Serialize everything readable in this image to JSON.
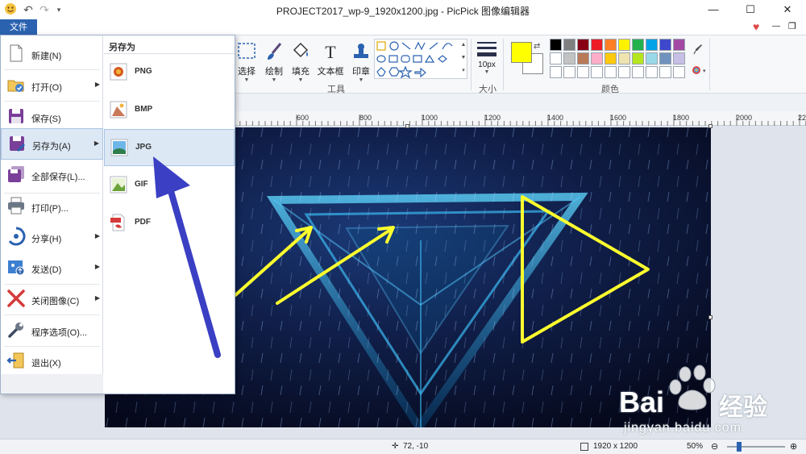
{
  "window": {
    "title": "PROJECT2017_wp-9_1920x1200.jpg - PicPick 图像编辑器",
    "minimize": "—",
    "maximize": "☐",
    "close": "✕"
  },
  "quick_access": {
    "undo": "↶",
    "redo": "↷",
    "more": "▾"
  },
  "ribbon_tab": {
    "file": "文件"
  },
  "ribbon_right": {
    "heart": "♥",
    "min": "—",
    "restore": "❐"
  },
  "ribbon": {
    "tools": [
      {
        "label": "选择",
        "icon": "select-icon"
      },
      {
        "label": "绘制",
        "icon": "brush-icon"
      },
      {
        "label": "填充",
        "icon": "bucket-icon"
      },
      {
        "label": "文本框",
        "icon": "text-icon"
      },
      {
        "label": "印章",
        "icon": "stamp-icon"
      }
    ],
    "tools_group_label": "工具",
    "size_label": "10px",
    "size_group_label": "大小",
    "colors_group_label": "颜色",
    "primary_color": "#ffff00",
    "secondary_color": "#ffffff",
    "palette": [
      "#000000",
      "#7f7f7f",
      "#880015",
      "#ed1c24",
      "#ff7f27",
      "#fff200",
      "#22b14c",
      "#00a2e8",
      "#3f48cc",
      "#a349a4",
      "#ffffff",
      "#c3c3c3",
      "#b97a57",
      "#ffaec9",
      "#ffc90e",
      "#efe4b0",
      "#b5e61d",
      "#99d9ea",
      "#7092be",
      "#c8bfe7",
      "#ffffff",
      "#ffffff",
      "#ffffff",
      "#ffffff",
      "#ffffff",
      "#ffffff",
      "#ffffff",
      "#ffffff",
      "#ffffff",
      "#ffffff"
    ]
  },
  "ruler": {
    "ticks": [
      "600",
      "800",
      "1000",
      "1200",
      "1400",
      "1600",
      "1800",
      "2000",
      "22"
    ]
  },
  "file_menu": {
    "items": [
      {
        "label": "新建(N)",
        "icon": "new-file-icon",
        "submenu": false
      },
      {
        "label": "打开(O)",
        "icon": "open-folder-icon",
        "submenu": true
      },
      {
        "label": "保存(S)",
        "icon": "save-icon",
        "submenu": false
      },
      {
        "label": "另存为(A)",
        "icon": "save-as-icon",
        "submenu": true
      },
      {
        "label": "全部保存(L)...",
        "icon": "save-all-icon",
        "submenu": false
      },
      {
        "label": "打印(P)...",
        "icon": "printer-icon",
        "submenu": false
      },
      {
        "label": "分享(H)",
        "icon": "share-icon",
        "submenu": true
      },
      {
        "label": "发送(D)",
        "icon": "send-icon",
        "submenu": true
      },
      {
        "label": "关闭图像(C)",
        "icon": "close-image-icon",
        "submenu": true
      },
      {
        "label": "程序选项(O)...",
        "icon": "wrench-icon",
        "submenu": false
      },
      {
        "label": "退出(X)",
        "icon": "exit-icon",
        "submenu": false
      }
    ],
    "submenu_arrow": "▶",
    "save_as_title": "另存为",
    "formats": [
      {
        "label": "PNG",
        "icon": "png-file-icon"
      },
      {
        "label": "BMP",
        "icon": "bmp-file-icon"
      },
      {
        "label": "JPG",
        "icon": "jpg-file-icon"
      },
      {
        "label": "GIF",
        "icon": "gif-file-icon"
      },
      {
        "label": "PDF",
        "icon": "pdf-file-icon"
      }
    ]
  },
  "status": {
    "cursor_pos": "72, -10",
    "image_size": "1920 x 1200",
    "zoom": "50%",
    "zoom_out": "⊖",
    "zoom_in": "⊕"
  },
  "watermark": {
    "brand": "Bai",
    "brand2": "经验",
    "url": "jingyan.baidu.com"
  }
}
